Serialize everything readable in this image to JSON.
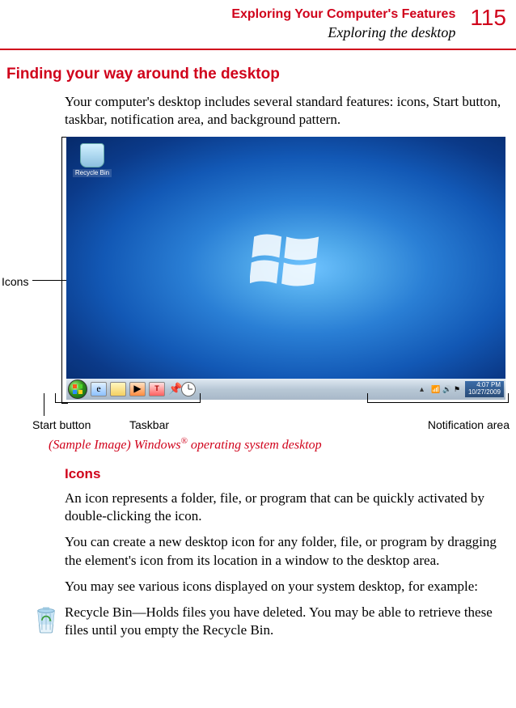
{
  "header": {
    "chapter": "Exploring Your Computer's Features",
    "section": "Exploring the desktop",
    "page_number": "115"
  },
  "main": {
    "title": "Finding your way around the desktop",
    "intro": "Your computer's desktop includes several standard features: icons, Start button, taskbar, notification area, and background pattern."
  },
  "figure": {
    "callouts": {
      "icons": "Icons",
      "start_button": "Start button",
      "taskbar": "Taskbar",
      "notification_area": "Notification area"
    },
    "recycle_bin_label": "Recycle Bin",
    "clock": {
      "time": "4:07 PM",
      "date": "10/27/2009"
    },
    "caption_prefix": "(Sample Image) Windows",
    "caption_suffix": " operating system desktop",
    "reg_mark": "®"
  },
  "icons_section": {
    "title": "Icons",
    "p1": "An icon represents a folder, file, or program that can be quickly activated by double-clicking the icon.",
    "p2": "You can create a new desktop icon for any folder, file, or program by dragging the element's icon from its location in a window to the desktop area.",
    "p3": "You may see various icons displayed on your system desktop, for example:",
    "recycle_bin_desc": "Recycle Bin—Holds files you have deleted. You may be able to retrieve these files until you empty the Recycle Bin."
  }
}
